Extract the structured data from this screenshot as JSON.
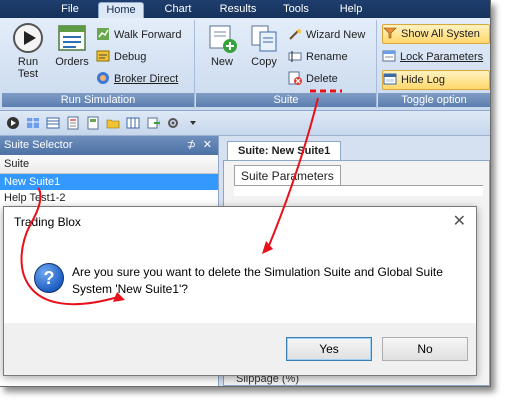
{
  "menu": {
    "tabs": [
      "File",
      "Home",
      "Chart",
      "Results",
      "Tools",
      "Help"
    ],
    "active": "Home"
  },
  "ribbon": {
    "simulation": {
      "title": "Run Simulation",
      "run_test": [
        "Run",
        "Test"
      ],
      "orders": "Orders",
      "walk_forward": "Walk Forward",
      "debug": "Debug",
      "broker_direct": "Broker Direct"
    },
    "suite": {
      "title": "Suite",
      "new": "New",
      "copy": "Copy",
      "wizard_new": "Wizard New",
      "rename": "Rename",
      "delete": "Delete"
    },
    "toggle": {
      "title": "Toggle option",
      "show_all_systems": "Show All Systen",
      "lock_parameters": "Lock Parameters",
      "hide_log": "Hide Log"
    }
  },
  "suite_selector": {
    "title": "Suite Selector",
    "pin_glyph": "⊅",
    "close_glyph": "✕",
    "column": "Suite",
    "rows": [
      "New Suite1",
      "Help Test1-2"
    ],
    "selected": "New Suite1"
  },
  "document": {
    "tab": "Suite: New Suite1",
    "subtab": "Suite Parameters",
    "behind_text": "Slippage (%)"
  },
  "dialog": {
    "title": "Trading Blox",
    "close": "✕",
    "message": "Are you sure you want to delete the Simulation Suite and Global Suite System 'New Suite1'?",
    "yes": "Yes",
    "no": "No"
  },
  "colors": {
    "ribbon_bg": "#c9d9ee",
    "selection": "#3399ff",
    "annotation": "#e8101a",
    "highlight": "#ffd86b"
  }
}
